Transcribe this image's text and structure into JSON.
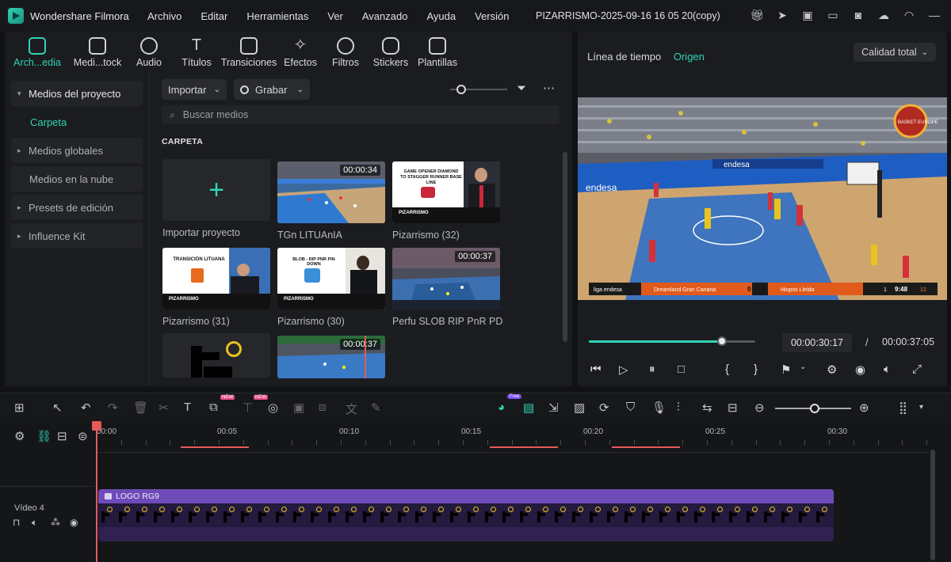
{
  "app": {
    "name": "Wondershare Filmora",
    "project": "PIZARRISMO-2025-09-16 16 05 20(copy)"
  },
  "menu": [
    "Archivo",
    "Editar",
    "Herramientas",
    "Ver",
    "Avanzado",
    "Ayuda",
    "Versión"
  ],
  "window_icons": [
    "gift-icon",
    "send-icon",
    "clipboard-icon",
    "monitor-icon",
    "save-icon",
    "cloud-upload-icon",
    "headset-icon",
    "minimize-icon"
  ],
  "tool_tabs": [
    {
      "label": "Arch...edia",
      "active": true
    },
    {
      "label": "Medi...tock"
    },
    {
      "label": "Audio"
    },
    {
      "label": "Títulos"
    },
    {
      "label": "Transiciones"
    },
    {
      "label": "Efectos"
    },
    {
      "label": "Filtros"
    },
    {
      "label": "Stickers"
    },
    {
      "label": "Plantillas"
    }
  ],
  "sidebar": {
    "items": [
      {
        "label": "Medios del proyecto",
        "arrow": "▾"
      },
      {
        "label": "Carpeta"
      },
      {
        "label": "Medios globales",
        "arrow": "▸"
      },
      {
        "label": "Medios en la nube"
      },
      {
        "label": "Presets de edición",
        "arrow": "▸"
      },
      {
        "label": "Influence Kit",
        "arrow": "▸"
      }
    ]
  },
  "media": {
    "import_btn": "Importar",
    "record_btn": "Grabar",
    "search_placeholder": "Buscar medios",
    "folder_title": "CARPETA",
    "items": [
      {
        "label": "Importar proyecto",
        "kind": "import"
      },
      {
        "label": "TGn LITUAnIA",
        "duration": "00:00:34",
        "kind": "court"
      },
      {
        "label": "Pizarrismo (32)",
        "kind": "title",
        "card_text": "GAME OPENER DIAMOND TO STAGGER RUNNER BASE LINE"
      },
      {
        "label": "Pizarrismo (31)",
        "kind": "title",
        "card_text": "TRANSICIÓN LITUANA"
      },
      {
        "label": "Pizarrismo (30)",
        "kind": "title",
        "card_text": "BLOB - RIP PNR PIN DOWN"
      },
      {
        "label": "Perfu SLOB RIP PnR PD",
        "duration": "00:00:37",
        "kind": "court"
      },
      {
        "label": "",
        "kind": "logo"
      },
      {
        "label": "",
        "duration": "00:00:37",
        "kind": "court"
      }
    ],
    "thumb_logo_text": "PIZARRISMO"
  },
  "preview": {
    "tab_timeline": "Línea de tiempo",
    "tab_source": "Origen",
    "quality": "Calidad total",
    "current_time": "00:00:30:17",
    "separator": "/",
    "total_time": "00:00:37:05",
    "progress": 0.8,
    "scoreboard": {
      "league": "liga endesa",
      "home": "Dreamland Gran Canaria",
      "home_score": "0",
      "away_score": "0",
      "away": "Hiopos Lleida",
      "quarter": "1",
      "clock": "9:48",
      "shot": "12"
    },
    "ad_text": "endesa",
    "badge_text": "BASKET EUROPE"
  },
  "timeline": {
    "ruler": [
      "00:00",
      "00:05",
      "00:10",
      "00:15",
      "00:20",
      "00:25",
      "00:30"
    ],
    "track_label": "Vídeo 4",
    "clip_label": "LOGO RG9",
    "badge_new": "NEW",
    "badge_free": "Free"
  },
  "colors": {
    "accent": "#30d3b5",
    "playhead": "#e55a5a",
    "clip": "#6e4bb8"
  }
}
